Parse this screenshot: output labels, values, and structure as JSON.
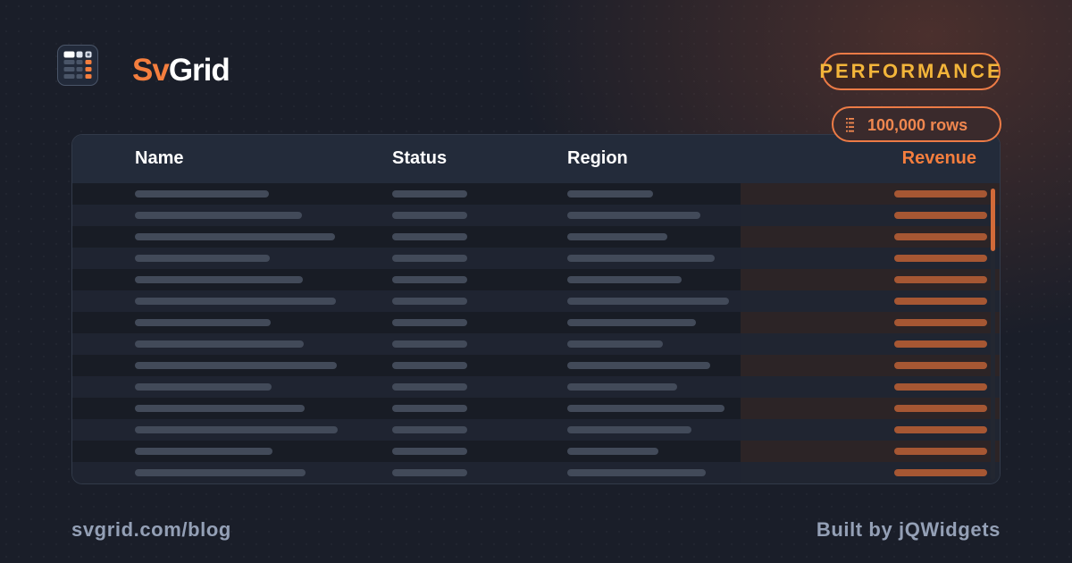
{
  "brand": {
    "prefix": "Sv",
    "suffix": "Grid",
    "icon": "grid-logo-icon"
  },
  "badges": {
    "performance": "PERFORMANCE",
    "rows": {
      "label": "100,000 rows",
      "icon": "rows-list-icon"
    }
  },
  "grid": {
    "columns": [
      {
        "key": "name",
        "label": "Name"
      },
      {
        "key": "status",
        "label": "Status"
      },
      {
        "key": "region",
        "label": "Region"
      },
      {
        "key": "revenue",
        "label": "Revenue"
      }
    ],
    "visible_row_count": 14,
    "scroll_position": 0
  },
  "footer": {
    "link": "svgrid.com/blog",
    "credit": "Built by jQWidgets"
  },
  "colors": {
    "accent": "#f47e3e",
    "performance_text": "#f3b53a",
    "background": "#1a1e29",
    "header_bg": "#232b3a"
  }
}
